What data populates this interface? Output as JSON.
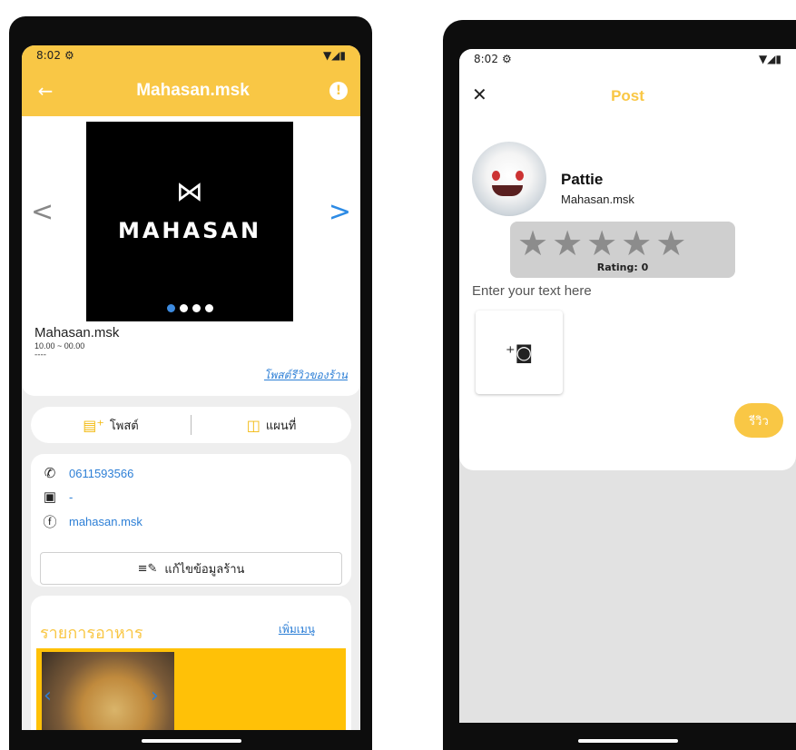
{
  "left_screen": {
    "status": {
      "time": "8:02",
      "settings_icon": "gear-icon",
      "signal_icons": "▼◢▮"
    },
    "appbar": {
      "back_icon": "←",
      "title": "Mahasan.msk",
      "info_icon": "!"
    },
    "hero": {
      "logo_mark": "⋈",
      "logo_text": "MAHASAN",
      "prev_icon": "<",
      "next_icon": ">",
      "shop_name": "Mahasan.msk",
      "hours": "10.00 ~ 00.00",
      "extra": "----",
      "review_link": "โพสต์รีวิวของร้าน"
    },
    "actions": {
      "post_label": "โพสต์",
      "map_label": "แผนที่"
    },
    "contact": {
      "phone": "0611593566",
      "line": "-",
      "facebook": "mahasan.msk",
      "edit_label": "แก้ไขข้อมูลร้าน"
    },
    "menu": {
      "title": "รายการอาหาร",
      "add_label": "เพิ่มเมนู"
    }
  },
  "right_screen": {
    "status": {
      "time": "8:02",
      "settings_icon": "gear-icon",
      "signal_icons": "▼◢▮"
    },
    "post": {
      "close_icon": "✕",
      "title": "Post",
      "user_name": "Pattie",
      "user_shop": "Mahasan.msk",
      "stars": [
        "★",
        "★",
        "★",
        "★",
        "★"
      ],
      "rating_label": "Rating: 0",
      "text_placeholder": "Enter your text here",
      "add_photo_icon": "add-photo-icon",
      "submit_label": "รีวิว"
    }
  },
  "colors": {
    "accent": "#f9c745",
    "link": "#2d7fd6",
    "dot_active": "#3d8be0"
  }
}
